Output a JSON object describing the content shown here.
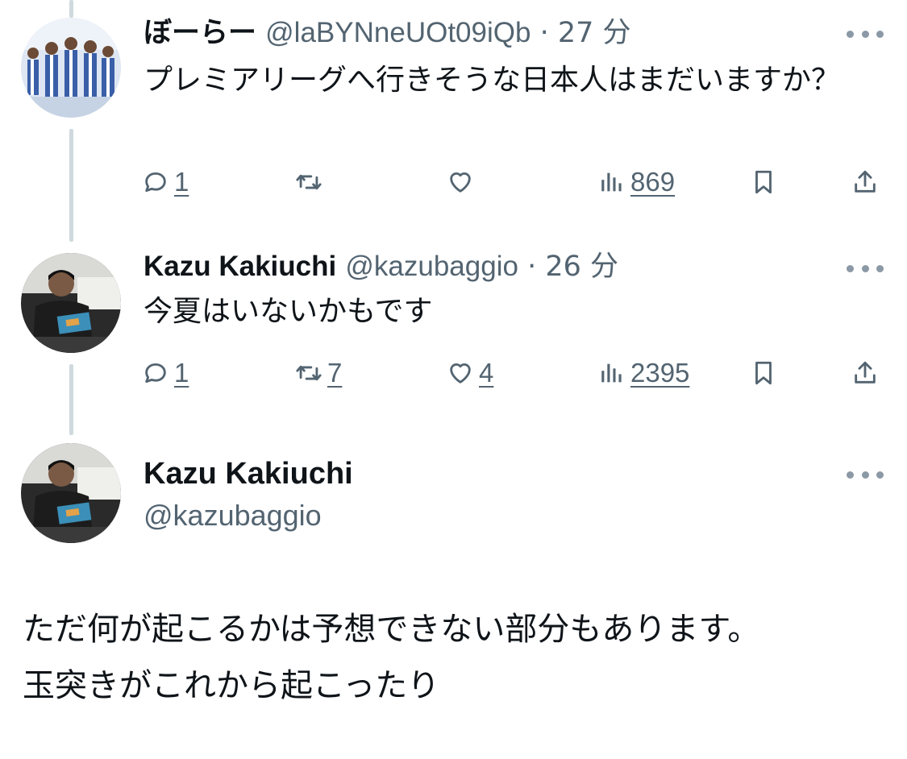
{
  "replies": [
    {
      "display_name": "ぼーらー",
      "handle": "@laBYNneUOt09iQb",
      "separator": "·",
      "time": "27 分",
      "text": "プレミアリーグへ行きそうな日本人はまだいますか？",
      "stats": {
        "replies": "1",
        "retweets": "",
        "likes": "",
        "views": "869"
      }
    },
    {
      "display_name": "Kazu Kakiuchi",
      "handle": "@kazubaggio",
      "separator": "·",
      "time": "26 分",
      "text": "今夏はいないかもです",
      "stats": {
        "replies": "1",
        "retweets": "7",
        "likes": "4",
        "views": "2395"
      }
    }
  ],
  "main_tweet": {
    "display_name": "Kazu Kakiuchi",
    "handle": "@kazubaggio",
    "lines": [
      "ただ何が起こるかは予想できない部分もあります。",
      "玉突きがこれから起こったり"
    ]
  },
  "icons": [
    "more-icon",
    "reply-icon",
    "retweet-icon",
    "like-icon",
    "views-icon",
    "bookmark-icon",
    "share-icon"
  ],
  "colors": {
    "text": "#0f1419",
    "secondary": "#536471",
    "thread_line": "#cfd9de"
  }
}
